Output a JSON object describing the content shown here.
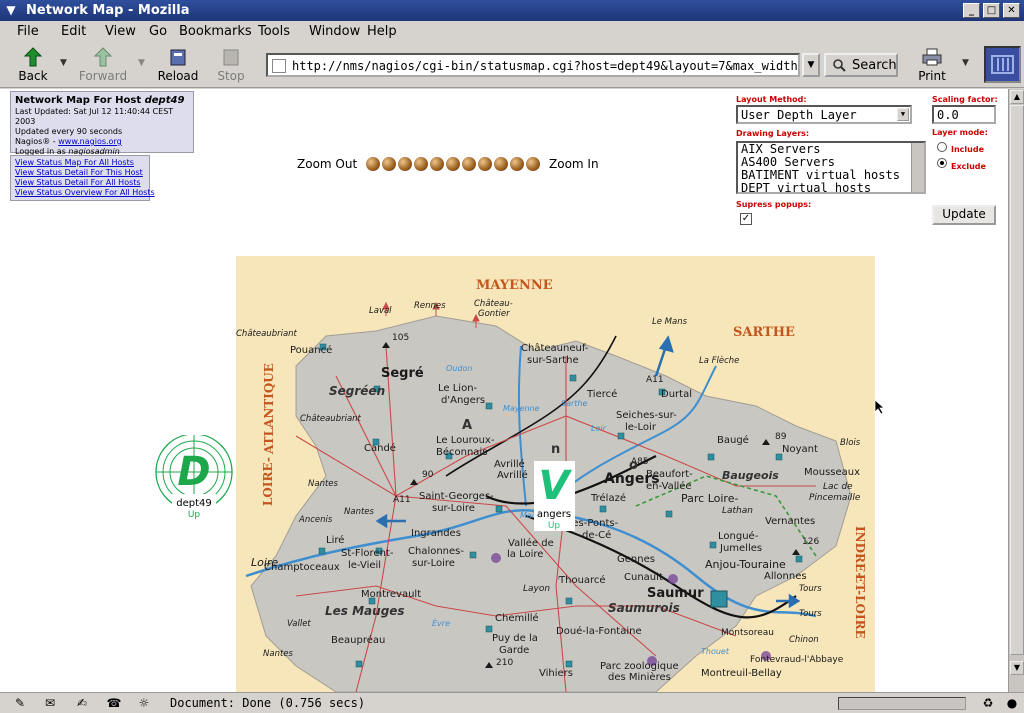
{
  "window": {
    "title": "Network Map - Mozilla"
  },
  "menu": [
    "File",
    "Edit",
    "View",
    "Go",
    "Bookmarks",
    "Tools",
    "Window",
    "Help"
  ],
  "toolbar": {
    "back": "Back",
    "forward": "Forward",
    "reload": "Reload",
    "stop": "Stop",
    "url": "http://nms/nagios/cgi-bin/statusmap.cgi?host=dept49&layout=7&max_width=0",
    "search": "Search",
    "print": "Print"
  },
  "info": {
    "header_prefix": "Network Map For Host",
    "header_host": "dept49",
    "last_updated": "Last Updated: Sat Jul 12 11:40:44 CEST 2003",
    "update_interval": "Updated every 90 seconds",
    "credit_prefix": "Nagios® - ",
    "credit_link": "www.nagios.org",
    "login_prefix": "Logged in as ",
    "login_user": "nagiosadmin"
  },
  "links": [
    "View Status Map For All Hosts",
    "View Status Detail For This Host",
    "View Status Detail For All Hosts",
    "View Status Overview For All Hosts"
  ],
  "zoom": {
    "out_label": "Zoom Out",
    "in_label": "Zoom In",
    "level_count": 11
  },
  "controls": {
    "layout_method_label": "Layout Method:",
    "layout_method_value": "User Depth Layer",
    "drawing_layers_label": "Drawing Layers:",
    "drawing_layers": [
      "AIX Servers",
      "AS400 Servers",
      "BATIMENT virtual hosts",
      "DEPT virtual hosts"
    ],
    "suppress_popups_label": "Supress popups:",
    "suppress_popups_checked": true,
    "scaling_label": "Scaling factor:",
    "scaling_value": "0.0",
    "layer_mode_label": "Layer mode:",
    "include_label": "Include",
    "exclude_label": "Exclude",
    "update_button": "Update"
  },
  "map": {
    "regions": {
      "north": "MAYENNE",
      "east": "SARTHE",
      "west_1": "LOIRE-",
      "west_2": "ATLANTIQUE",
      "south_east_1": "INDRE-",
      "south_east_2": "ET-LOIRE"
    },
    "cities": {
      "laval": "Laval",
      "rennes": "Rennes",
      "chateau_gontier_1": "Château-",
      "chateau_gontier_2": "Gontier",
      "le_mans": "Le Mans",
      "chateaubriant_1": "Châteaubriant",
      "pouance": "Pouancé",
      "n105": "105",
      "segre": "Segré",
      "segreen": "Segréen",
      "chateauneuf_1": "Châteauneuf-",
      "chateauneuf_2": "sur-Sarthe",
      "la_fleche": "La Flèche",
      "tierce": "Tiercé",
      "durtal": "Durtal",
      "le_lion_1": "Le Lion-",
      "le_lion_2": "d'Angers",
      "chateaubriant_2": "Châteaubriant",
      "candé": "Candé",
      "louroux_1": "Le Louroux-",
      "louroux_2": "Béconnais",
      "seiches_1": "Seiches-sur-",
      "seiches_2": "le-Loir",
      "bauge": "Baugé",
      "noyant": "Noyant",
      "n89": "89",
      "blois": "Blois",
      "a85": "A85",
      "angers": "Angers",
      "avrille": "Avrillé",
      "angers_small": "Angers",
      "n90": "90",
      "nantes_1": "Nantes",
      "st_georges_1": "Saint-Georges-",
      "st_georges_2": "sur-Loire",
      "beaufort_1": "Beaufort-",
      "beaufort_2": "en-Vallée",
      "baugeois": "Baugeois",
      "mousseaux": "Mousseaux",
      "lac_1": "Lac de",
      "lac_2": "Pincemaille",
      "a11": "A11",
      "nantes_2": "Nantes",
      "ancenis": "Ancenis",
      "trelaze": "Trélazé",
      "parc_loire": "Parc Loire-",
      "lathan": "Lathan",
      "vernantes": "Vernantes",
      "loire": "Loire",
      "lire": "Liré",
      "ingrandes": "Ingrandes",
      "ponts_1": "Les-Ponts-",
      "ponts_2": "de-Cé",
      "longue_1": "Longué-",
      "longue_2": "Jumelles",
      "n126": "126",
      "champtoceaux": "Champtoceaux",
      "st_florent_1": "St-Florent-",
      "st_florent_2": "le-Vieil",
      "chalonnes_1": "Chalonnes-",
      "chalonnes_2": "sur-Loire",
      "vallee_1": "Vallée de",
      "vallee_2": "la Loire",
      "gennes": "Gennes",
      "anjou": "Anjou-Touraine",
      "allonnes": "Allonnes",
      "cunault": "Cunault",
      "montrevault": "Montrevault",
      "thouarce": "Thouarcé",
      "saumur": "Saumur",
      "tours_1": "Tours",
      "les_mauges": "Les Mauges",
      "layon": "Layon",
      "saumurois": "Saumurois",
      "tours_2": "Tours",
      "vallet": "Vallet",
      "chemille": "Chemillé",
      "montsoreau": "Montsoreau",
      "chinon": "Chinon",
      "beaupreau": "Beaupréau",
      "puy_1": "Puy de la",
      "puy_2": "Garde",
      "n210": "210",
      "doue": "Doué-la-Fontaine",
      "fontevraud": "Fontevraud-l'Abbaye",
      "nantes_3": "Nantes",
      "vihiers": "Vihiers",
      "parc_zoo_1": "Parc zoologique",
      "parc_zoo_2": "des Minières",
      "montreuil": "Montreuil-Bellay",
      "evre": "Èvre",
      "oudon": "Oudon",
      "mayenne_river": "Mayenne",
      "sarthe_river": "Sarthe",
      "loir_river": "Loir",
      "maine": "Maine",
      "thouet": "Thouet",
      "a11_b": "A11",
      "a": "A",
      "n": "n",
      "o": "o"
    }
  },
  "hosts": [
    {
      "letter": "D",
      "name": "dept49",
      "status": "Up",
      "color": "#1ca84a"
    },
    {
      "letter": "V",
      "name": "angers",
      "status": "Up",
      "color": "#1ec07a"
    }
  ],
  "statusbar": {
    "text": "Document: Done (0.756 secs)"
  }
}
